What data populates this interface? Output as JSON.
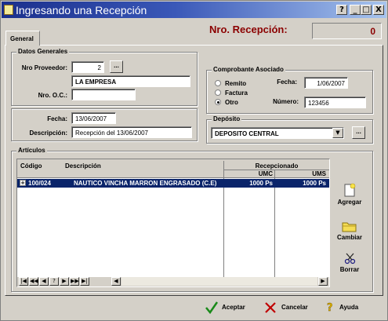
{
  "window": {
    "title": "Ingresando una Recepción",
    "controls": [
      "?",
      "_",
      "□",
      "X"
    ]
  },
  "tab": {
    "label": "General"
  },
  "header": {
    "nro_label": "Nro. Recepción:",
    "nro_value": "0"
  },
  "datos_generales": {
    "title": "Datos Generales",
    "proveedor_label": "Nro Proveedor:",
    "proveedor_value": "2",
    "proveedor_name": "LA EMPRESA",
    "oc_label": "Nro. O.C.:",
    "oc_value": "",
    "browse_label": "..."
  },
  "fecha_section": {
    "fecha_label": "Fecha:",
    "fecha_value": "13/06/2007",
    "descripcion_label": "Descripción:",
    "descripcion_value": "Recepción del 13/06/2007"
  },
  "comprobante": {
    "title": "Comprobante Asociado",
    "options": [
      "Remito",
      "Factura",
      "Otro"
    ],
    "selected": "Otro",
    "fecha_label": "Fecha:",
    "fecha_value": "1/06/2007",
    "numero_label": "Número:",
    "numero_value": "123456"
  },
  "deposito": {
    "title": "Depósito",
    "value": "DEPOSITO CENTRAL",
    "browse_label": "..."
  },
  "articulos": {
    "title": "Artículos",
    "columns": {
      "codigo": "Código",
      "descripcion": "Descripción",
      "recepcionado": "Recepcionado",
      "umc": "UMC",
      "ums": "UMS"
    },
    "rows": [
      {
        "expand": "+",
        "codigo": "100/024",
        "descripcion": "NAUTICO VINCHA MARRON ENGRASADO (C.E)",
        "umc": "1000 Ps",
        "ums": "1000 Ps"
      }
    ],
    "nav": [
      "|◀",
      "◀◀",
      "◀",
      "?",
      "▶",
      "▶▶",
      "▶|"
    ],
    "scroll_left": "◀",
    "scroll_right": "▶"
  },
  "side_buttons": {
    "agregar": "Agregar",
    "cambiar": "Cambiar",
    "borrar": "Borrar"
  },
  "footer": {
    "aceptar": "Aceptar",
    "cancelar": "Cancelar",
    "ayuda": "Ayuda"
  },
  "icons": {
    "title": "form-icon",
    "agregar": "new-document-icon",
    "cambiar": "folder-icon",
    "borrar": "scissors-icon",
    "aceptar": "checkmark-icon",
    "cancelar": "x-cross-icon",
    "ayuda": "help-icon"
  },
  "colors": {
    "title_start": "#1a2f8c",
    "title_end": "#a7c4ee",
    "nro_text": "#8b0000",
    "row_highlight": "#0a246a",
    "check_green": "#1a8a1a",
    "cancel_red": "#c00000"
  }
}
